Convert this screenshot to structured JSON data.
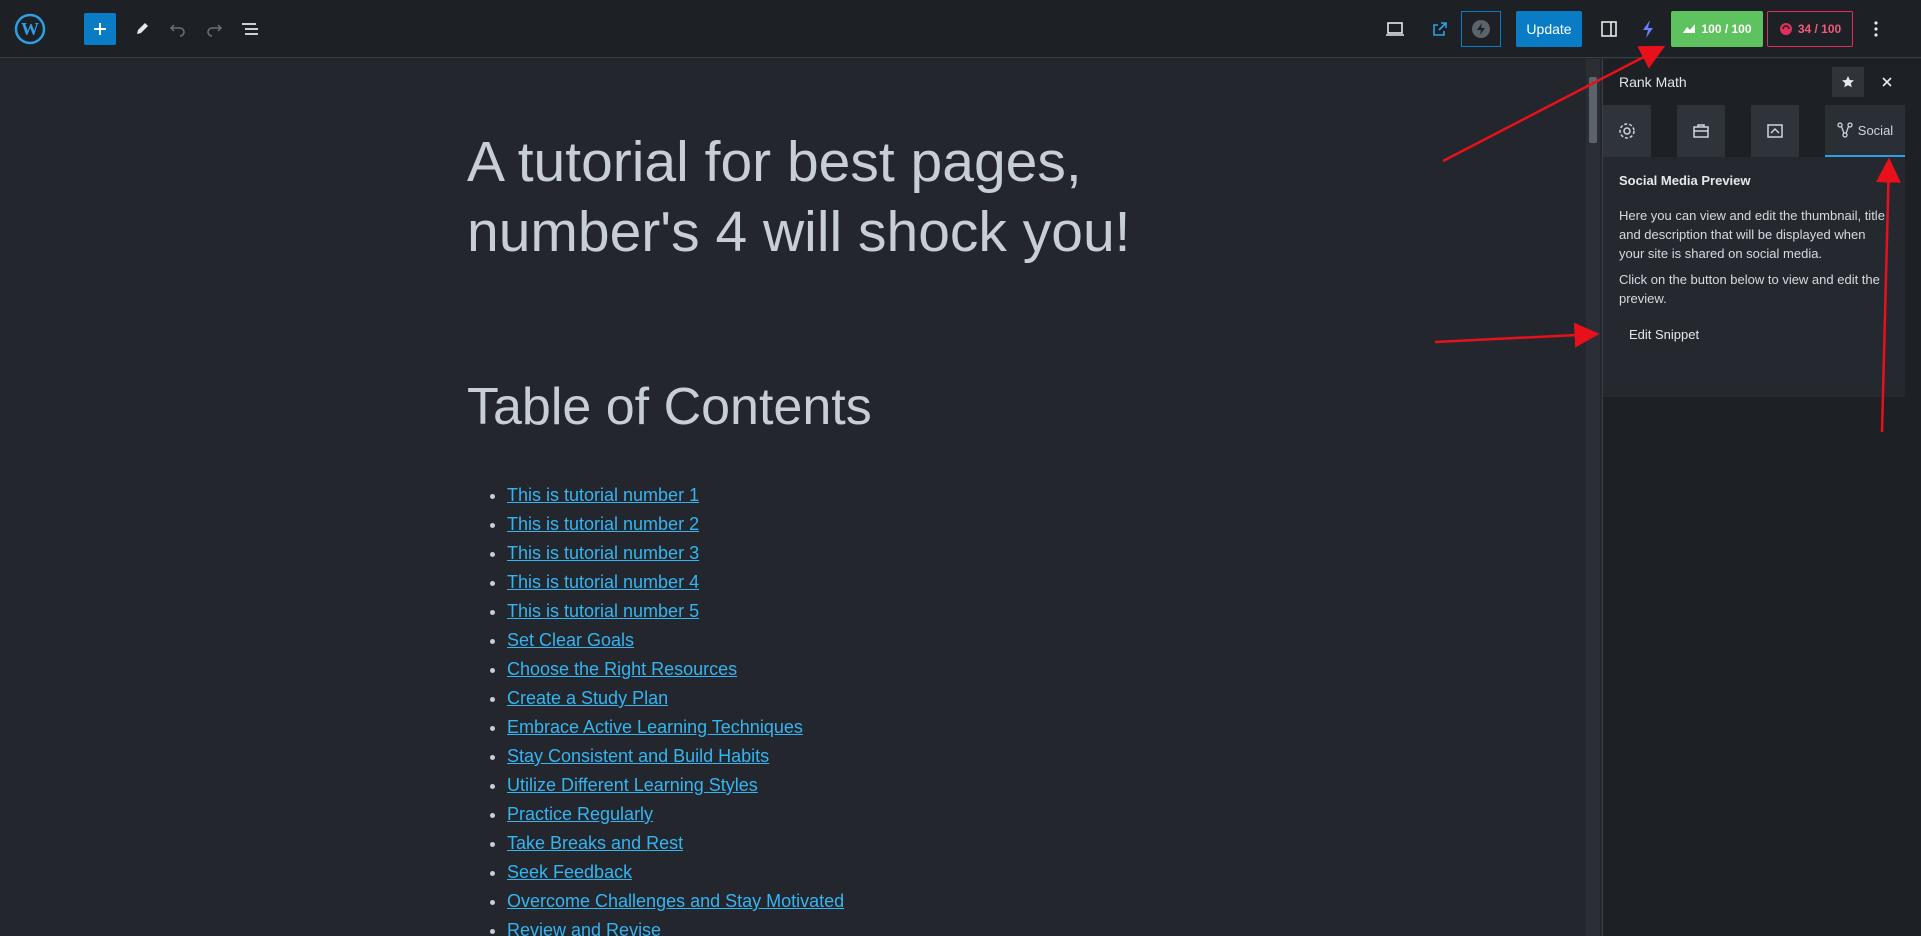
{
  "toolbar": {
    "update_label": "Update",
    "seo_score": "100 / 100",
    "readability_score": "34 / 100"
  },
  "editor": {
    "post_title": "A tutorial for best pages, number's 4 will shock you!",
    "toc_heading": "Table of Contents",
    "toc_items": [
      "This is tutorial number 1",
      "This is tutorial number 2",
      "This is tutorial number 3",
      "This is tutorial number 4",
      "This is tutorial number 5",
      "Set Clear Goals",
      "Choose the Right Resources",
      "Create a Study Plan",
      "Embrace Active Learning Techniques",
      "Stay Consistent and Build Habits",
      "Utilize Different Learning Styles",
      "Practice Regularly",
      "Take Breaks and Rest",
      "Seek Feedback",
      "Overcome Challenges and Stay Motivated",
      "Review and Revise"
    ]
  },
  "sidebar": {
    "title": "Rank Math",
    "active_tab_label": "Social",
    "panel_heading": "Social Media Preview",
    "panel_text_1": "Here you can view and edit the thumbnail, title and description that will be displayed when your site is shared on social media.",
    "panel_text_2": "Click on the button below to view and edit the preview.",
    "edit_snippet_label": "Edit Snippet"
  },
  "colors": {
    "accent": "#0a7cc5",
    "score_green": "#5ec35e",
    "score_red": "#e0305a",
    "link": "#35b4f0",
    "annotation_arrow": "#e8101a"
  },
  "icons": [
    "wordpress-logo-icon",
    "plus-icon",
    "pencil-icon",
    "undo-icon",
    "redo-icon",
    "list-view-icon",
    "desktop-preview-icon",
    "external-link-icon",
    "bolt-circle-icon",
    "sidebar-toggle-icon",
    "lightning-icon",
    "more-vertical-icon",
    "star-icon",
    "close-icon",
    "gear-icon",
    "briefcase-icon",
    "snippet-icon",
    "share-nodes-icon"
  ]
}
